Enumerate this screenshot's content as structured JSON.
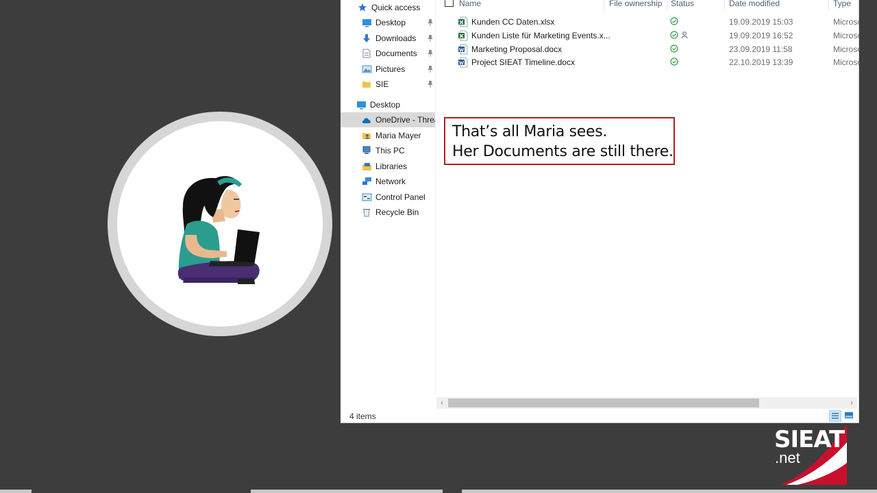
{
  "nav": {
    "items": [
      {
        "label": "Quick access",
        "icon": "star-icon"
      },
      {
        "label": "Desktop",
        "icon": "desktop-icon"
      },
      {
        "label": "Downloads",
        "icon": "download-icon"
      },
      {
        "label": "Documents",
        "icon": "document-icon"
      },
      {
        "label": "Pictures",
        "icon": "picture-icon"
      },
      {
        "label": "SIE",
        "icon": "folder-icon"
      },
      {
        "label": "Desktop",
        "icon": "desktop-icon"
      },
      {
        "label": "OneDrive - Threat",
        "icon": "cloud-icon"
      },
      {
        "label": "Maria Mayer",
        "icon": "user-folder-icon"
      },
      {
        "label": "This PC",
        "icon": "computer-icon"
      },
      {
        "label": "Libraries",
        "icon": "library-icon"
      },
      {
        "label": "Network",
        "icon": "network-icon"
      },
      {
        "label": "Control Panel",
        "icon": "control-panel-icon"
      },
      {
        "label": "Recycle Bin",
        "icon": "recycle-bin-icon"
      }
    ]
  },
  "columns": {
    "name": "Name",
    "ownership": "File ownership",
    "status": "Status",
    "modified": "Date modified",
    "type": "Type"
  },
  "files": [
    {
      "name": "Kunden CC Daten.xlsx",
      "kind": "excel",
      "date": "19.09.2019 15:03",
      "type": "Microsoft",
      "shared": false
    },
    {
      "name": "Kunden Liste für Marketing Events.x...",
      "kind": "excel",
      "date": "19.09.2019 16:52",
      "type": "Microsoft",
      "shared": true
    },
    {
      "name": "Marketing Proposal.docx",
      "kind": "word",
      "date": "23.09.2019 11:58",
      "type": "Microsoft",
      "shared": false
    },
    {
      "name": "Project SIEAT Timeline.docx",
      "kind": "word",
      "date": "22.10.2019 13:39",
      "type": "Microsoft",
      "shared": false
    }
  ],
  "status": {
    "item_count": "4 items"
  },
  "callout": {
    "line1": "That’s all Maria sees.",
    "line2": "Her Documents are still there."
  },
  "logo": {
    "line1": "SIEAT",
    "line2": ".net"
  },
  "colors": {
    "excel": "#1d6f42",
    "word": "#2b579a",
    "sync_ok": "#2e9e44",
    "callout_border": "#b11e1e",
    "selection": "#cce8ff"
  }
}
